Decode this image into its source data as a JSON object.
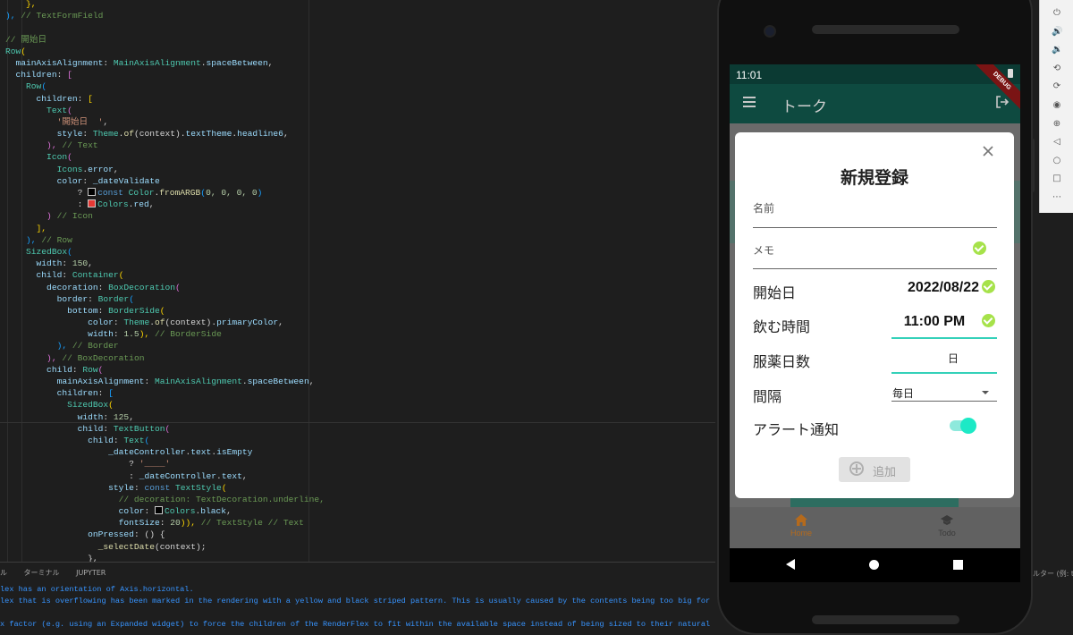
{
  "editor": {
    "lines": [
      [
        {
          "t": "    },",
          "c": "tok-b1"
        }
      ],
      [
        {
          "t": "), ",
          "c": "tok-b3"
        },
        {
          "t": "// TextFormField",
          "c": "tok-cmt"
        }
      ],
      [
        {
          "t": "",
          "c": ""
        }
      ],
      [
        {
          "t": "// 開始日",
          "c": "tok-cmt"
        }
      ],
      [
        {
          "t": "Row",
          "c": "tok-fn"
        },
        {
          "t": "(",
          "c": "tok-b1"
        }
      ],
      [
        {
          "t": "  mainAxisAlignment",
          "c": "tok-prop"
        },
        {
          "t": ": ",
          "c": ""
        },
        {
          "t": "MainAxisAlignment",
          "c": "tok-fn"
        },
        {
          "t": ".",
          "c": ""
        },
        {
          "t": "spaceBetween",
          "c": "tok-prop"
        },
        {
          "t": ",",
          "c": ""
        }
      ],
      [
        {
          "t": "  children",
          "c": "tok-prop"
        },
        {
          "t": ": ",
          "c": ""
        },
        {
          "t": "[",
          "c": "tok-b2"
        }
      ],
      [
        {
          "t": "    Row",
          "c": "tok-fn"
        },
        {
          "t": "(",
          "c": "tok-b3"
        }
      ],
      [
        {
          "t": "      children",
          "c": "tok-prop"
        },
        {
          "t": ": ",
          "c": ""
        },
        {
          "t": "[",
          "c": "tok-b1"
        }
      ],
      [
        {
          "t": "        Text",
          "c": "tok-fn"
        },
        {
          "t": "(",
          "c": "tok-b2"
        }
      ],
      [
        {
          "t": "          '開始日  '",
          "c": "tok-str"
        },
        {
          "t": ",",
          "c": ""
        }
      ],
      [
        {
          "t": "          style",
          "c": "tok-prop"
        },
        {
          "t": ": ",
          "c": ""
        },
        {
          "t": "Theme",
          "c": "tok-fn"
        },
        {
          "t": ".",
          "c": ""
        },
        {
          "t": "of",
          "c": "tok-call"
        },
        {
          "t": "(context).",
          "c": ""
        },
        {
          "t": "textTheme",
          "c": "tok-prop"
        },
        {
          "t": ".",
          "c": ""
        },
        {
          "t": "headline6",
          "c": "tok-prop"
        },
        {
          "t": ",",
          "c": ""
        }
      ],
      [
        {
          "t": "        ), ",
          "c": "tok-b2"
        },
        {
          "t": "// Text",
          "c": "tok-cmt"
        }
      ],
      [
        {
          "t": "        Icon",
          "c": "tok-fn"
        },
        {
          "t": "(",
          "c": "tok-b2"
        }
      ],
      [
        {
          "t": "          Icons",
          "c": "tok-fn"
        },
        {
          "t": ".",
          "c": ""
        },
        {
          "t": "error",
          "c": "tok-prop"
        },
        {
          "t": ",",
          "c": ""
        }
      ],
      [
        {
          "t": "          color",
          "c": "tok-prop"
        },
        {
          "t": ": ",
          "c": ""
        },
        {
          "t": "_dateValidate",
          "c": "tok-prop"
        }
      ],
      [
        {
          "t": "              ? ",
          "c": ""
        },
        {
          "t": "SW_BLACK",
          "c": "sw"
        },
        {
          "t": "const ",
          "c": "tok-kw"
        },
        {
          "t": "Color",
          "c": "tok-fn"
        },
        {
          "t": ".",
          "c": ""
        },
        {
          "t": "fromARGB",
          "c": "tok-call"
        },
        {
          "t": "(",
          "c": "tok-b3"
        },
        {
          "t": "0, 0, 0, 0",
          "c": "tok-num"
        },
        {
          "t": ")",
          "c": "tok-b3"
        }
      ],
      [
        {
          "t": "              : ",
          "c": ""
        },
        {
          "t": "SW_RED",
          "c": "sw"
        },
        {
          "t": "Colors",
          "c": "tok-fn"
        },
        {
          "t": ".",
          "c": ""
        },
        {
          "t": "red",
          "c": "tok-prop"
        },
        {
          "t": ",",
          "c": ""
        }
      ],
      [
        {
          "t": "        ) ",
          "c": "tok-b2"
        },
        {
          "t": "// Icon",
          "c": "tok-cmt"
        }
      ],
      [
        {
          "t": "      ],",
          "c": "tok-b1"
        }
      ],
      [
        {
          "t": "    ), ",
          "c": "tok-b3"
        },
        {
          "t": "// Row",
          "c": "tok-cmt"
        }
      ],
      [
        {
          "t": "    SizedBox",
          "c": "tok-fn"
        },
        {
          "t": "(",
          "c": "tok-b3"
        }
      ],
      [
        {
          "t": "      width",
          "c": "tok-prop"
        },
        {
          "t": ": ",
          "c": ""
        },
        {
          "t": "150",
          "c": "tok-num"
        },
        {
          "t": ",",
          "c": ""
        }
      ],
      [
        {
          "t": "      child",
          "c": "tok-prop"
        },
        {
          "t": ": ",
          "c": ""
        },
        {
          "t": "Container",
          "c": "tok-fn"
        },
        {
          "t": "(",
          "c": "tok-b1"
        }
      ],
      [
        {
          "t": "        decoration",
          "c": "tok-prop"
        },
        {
          "t": ": ",
          "c": ""
        },
        {
          "t": "BoxDecoration",
          "c": "tok-fn"
        },
        {
          "t": "(",
          "c": "tok-b2"
        }
      ],
      [
        {
          "t": "          border",
          "c": "tok-prop"
        },
        {
          "t": ": ",
          "c": ""
        },
        {
          "t": "Border",
          "c": "tok-fn"
        },
        {
          "t": "(",
          "c": "tok-b3"
        }
      ],
      [
        {
          "t": "            bottom",
          "c": "tok-prop"
        },
        {
          "t": ": ",
          "c": ""
        },
        {
          "t": "BorderSide",
          "c": "tok-fn"
        },
        {
          "t": "(",
          "c": "tok-b1"
        }
      ],
      [
        {
          "t": "                color",
          "c": "tok-prop"
        },
        {
          "t": ": ",
          "c": ""
        },
        {
          "t": "Theme",
          "c": "tok-fn"
        },
        {
          "t": ".",
          "c": ""
        },
        {
          "t": "of",
          "c": "tok-call"
        },
        {
          "t": "(context).",
          "c": ""
        },
        {
          "t": "primaryColor",
          "c": "tok-prop"
        },
        {
          "t": ",",
          "c": ""
        }
      ],
      [
        {
          "t": "                width",
          "c": "tok-prop"
        },
        {
          "t": ": ",
          "c": ""
        },
        {
          "t": "1.5",
          "c": "tok-num"
        },
        {
          "t": "), ",
          "c": "tok-b1"
        },
        {
          "t": "// BorderSide",
          "c": "tok-cmt"
        }
      ],
      [
        {
          "t": "          ), ",
          "c": "tok-b3"
        },
        {
          "t": "// Border",
          "c": "tok-cmt"
        }
      ],
      [
        {
          "t": "        ), ",
          "c": "tok-b2"
        },
        {
          "t": "// BoxDecoration",
          "c": "tok-cmt"
        }
      ],
      [
        {
          "t": "        child",
          "c": "tok-prop"
        },
        {
          "t": ": ",
          "c": ""
        },
        {
          "t": "Row",
          "c": "tok-fn"
        },
        {
          "t": "(",
          "c": "tok-b2"
        }
      ],
      [
        {
          "t": "          mainAxisAlignment",
          "c": "tok-prop"
        },
        {
          "t": ": ",
          "c": ""
        },
        {
          "t": "MainAxisAlignment",
          "c": "tok-fn"
        },
        {
          "t": ".",
          "c": ""
        },
        {
          "t": "spaceBetween",
          "c": "tok-prop"
        },
        {
          "t": ",",
          "c": ""
        }
      ],
      [
        {
          "t": "          children",
          "c": "tok-prop"
        },
        {
          "t": ": ",
          "c": ""
        },
        {
          "t": "[",
          "c": "tok-b3"
        }
      ],
      [
        {
          "t": "            SizedBox",
          "c": "tok-fn"
        },
        {
          "t": "(",
          "c": "tok-b1"
        }
      ],
      [
        {
          "t": "              width",
          "c": "tok-prop"
        },
        {
          "t": ": ",
          "c": ""
        },
        {
          "t": "125",
          "c": "tok-num"
        },
        {
          "t": ",",
          "c": ""
        }
      ],
      [
        {
          "t": "              child",
          "c": "tok-prop"
        },
        {
          "t": ": ",
          "c": ""
        },
        {
          "t": "TextButton",
          "c": "tok-fn"
        },
        {
          "t": "(",
          "c": "tok-b2"
        }
      ],
      [
        {
          "t": "                child",
          "c": "tok-prop"
        },
        {
          "t": ": ",
          "c": ""
        },
        {
          "t": "Text",
          "c": "tok-fn"
        },
        {
          "t": "(",
          "c": "tok-b3"
        }
      ],
      [
        {
          "t": "                    _dateController",
          "c": "tok-prop"
        },
        {
          "t": ".",
          "c": ""
        },
        {
          "t": "text",
          "c": "tok-prop"
        },
        {
          "t": ".",
          "c": ""
        },
        {
          "t": "isEmpty",
          "c": "tok-prop"
        }
      ],
      [
        {
          "t": "                        ? ",
          "c": ""
        },
        {
          "t": "'____'",
          "c": "tok-str"
        }
      ],
      [
        {
          "t": "                        : ",
          "c": ""
        },
        {
          "t": "_dateController",
          "c": "tok-prop"
        },
        {
          "t": ".",
          "c": ""
        },
        {
          "t": "text",
          "c": "tok-prop"
        },
        {
          "t": ",",
          "c": ""
        }
      ],
      [
        {
          "t": "                    style",
          "c": "tok-prop"
        },
        {
          "t": ": ",
          "c": ""
        },
        {
          "t": "const ",
          "c": "tok-kw"
        },
        {
          "t": "TextStyle",
          "c": "tok-fn"
        },
        {
          "t": "(",
          "c": "tok-b1"
        }
      ],
      [
        {
          "t": "                      // decoration: TextDecoration.underline,",
          "c": "tok-cmt"
        }
      ],
      [
        {
          "t": "                      color",
          "c": "tok-prop"
        },
        {
          "t": ": ",
          "c": ""
        },
        {
          "t": "SW_BLACK",
          "c": "sw"
        },
        {
          "t": "Colors",
          "c": "tok-fn"
        },
        {
          "t": ".",
          "c": ""
        },
        {
          "t": "black",
          "c": "tok-prop"
        },
        {
          "t": ",",
          "c": ""
        }
      ],
      [
        {
          "t": "                      fontSize",
          "c": "tok-prop"
        },
        {
          "t": ": ",
          "c": ""
        },
        {
          "t": "20",
          "c": "tok-num"
        },
        {
          "t": ")), ",
          "c": "tok-b1"
        },
        {
          "t": "// TextStyle // Text",
          "c": "tok-cmt"
        }
      ],
      [
        {
          "t": "                onPressed",
          "c": "tok-prop"
        },
        {
          "t": ": () {",
          "c": ""
        }
      ],
      [
        {
          "t": "                  _selectDate",
          "c": "tok-call"
        },
        {
          "t": "(context);",
          "c": ""
        }
      ],
      [
        {
          "t": "                },",
          "c": ""
        }
      ]
    ],
    "swatches": {
      "SW_BLACK": "#000000",
      "SW_RED": "#e53935"
    }
  },
  "panel": {
    "tabs": [
      "ル",
      "ターミナル",
      "JUPYTER"
    ],
    "lines": [
      "lex has an orientation of Axis.horizontal.",
      "lex that is overflowing has been marked in the rendering with a yellow and black striped pattern. This is usually caused by the contents being too big for the",
      "",
      "x factor (e.g. using an Expanded widget) to force the children of the RenderFlex to fit within the available space instead of being sized to their natural siz"
    ],
    "filter_hint": "ルター (例: tex"
  },
  "phone": {
    "status_time": "11:01",
    "debug_banner": "DEBUG",
    "appbar_title": "トーク",
    "nav": {
      "home": "Home",
      "todo": "Todo"
    }
  },
  "dialog": {
    "title": "新規登録",
    "name_label": "名前",
    "memo_label": "メモ",
    "start_date_label": "開始日",
    "start_date_value": "2022/08/22",
    "time_label": "飲む時間",
    "time_value": "11:00 PM",
    "days_label": "服薬日数",
    "days_unit": "日",
    "interval_label": "間隔",
    "interval_value": "毎日",
    "alert_label": "アラート通知",
    "alert_enabled": true,
    "add_button": "追加",
    "accent_color": "#34d1b9",
    "check_color": "#a6e24a"
  },
  "emulator_toolbar": {
    "icons": [
      "power-icon",
      "volume-up-icon",
      "volume-down-icon",
      "rotate-left-icon",
      "rotate-right-icon",
      "camera-icon",
      "zoom-icon",
      "back-icon",
      "home-icon",
      "overview-icon",
      "more-icon"
    ],
    "glyphs": [
      "⏻",
      "🔊",
      "🔉",
      "⟲",
      "⟳",
      "◉",
      "⊕",
      "◁",
      "○",
      "□",
      "⋯"
    ]
  }
}
